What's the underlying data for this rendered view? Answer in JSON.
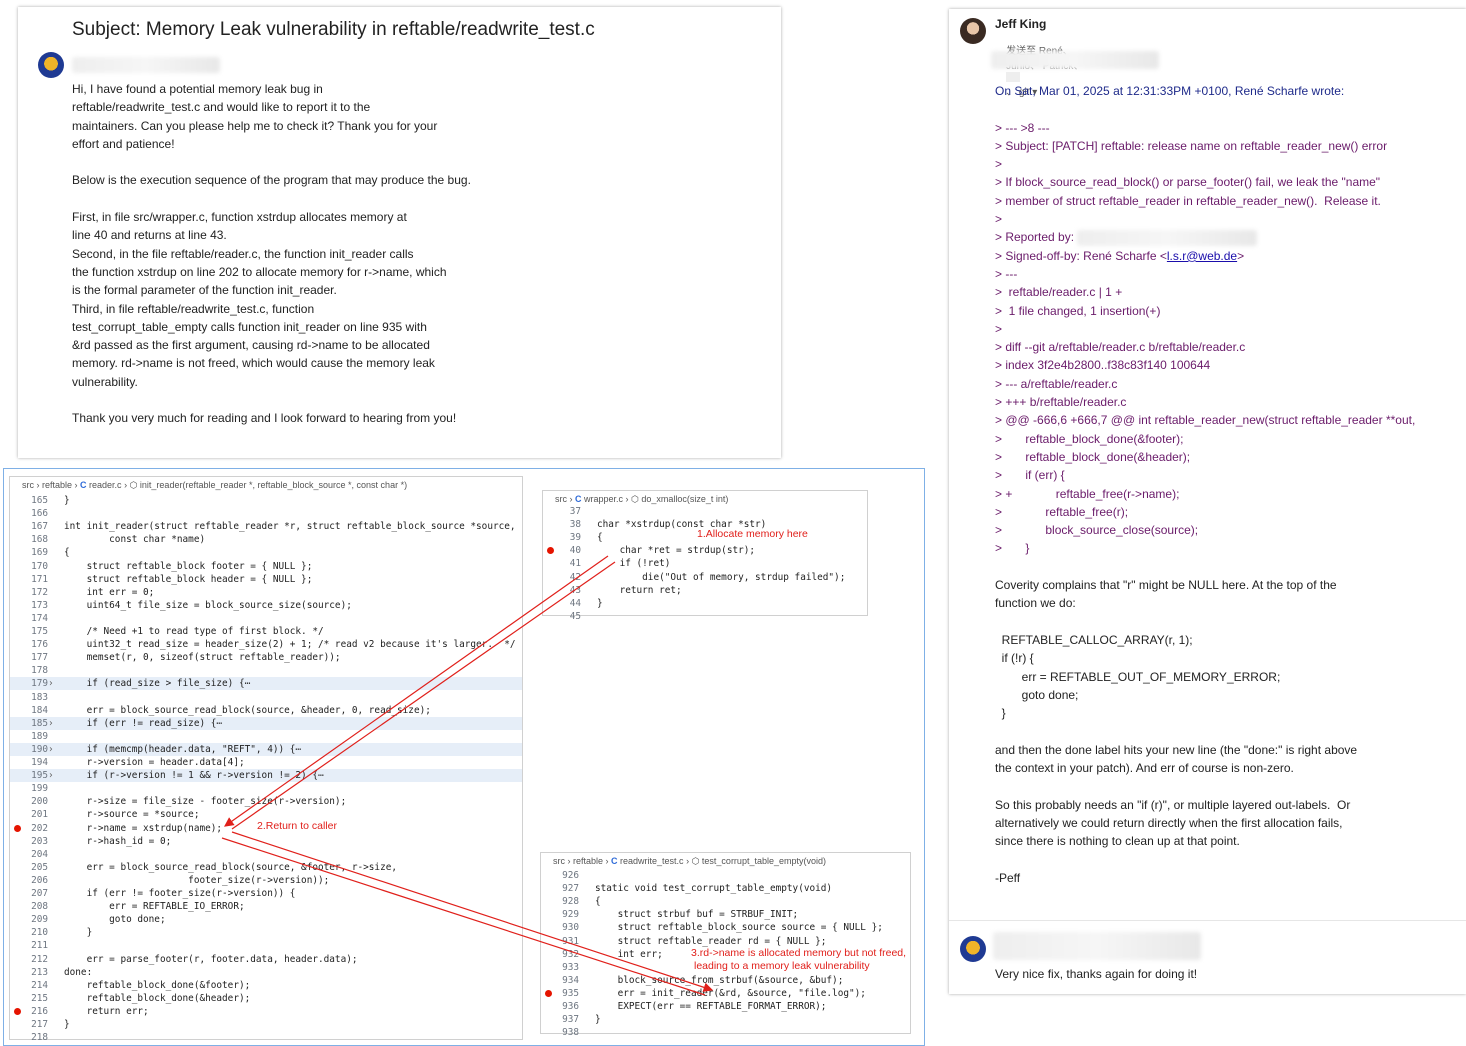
{
  "email_left": {
    "subject": "Subject: Memory Leak vulnerability in reftable/readwrite_test.c",
    "lines": [
      "Hi, I have found a potential memory leak bug in",
      "reftable/readwrite_test.c and would like to report it to the",
      "maintainers. Can you please help me to check it? Thank you for your",
      "effort and patience!",
      "",
      "Below is the execution sequence of the program that may produce the bug.",
      "",
      "First, in file src/wrapper.c, function xstrdup allocates memory at",
      "line 40 and returns at line 43.",
      "Second, in the file reftable/reader.c, the function init_reader calls",
      "the function xstrdup on line 202 to allocate memory for r->name, which",
      "is the formal parameter of the function init_reader.",
      "Third, in file reftable/readwrite_test.c, function",
      "test_corrupt_table_empty calls function init_reader on line 935 with",
      "&rd passed as the first argument, causing rd->name to be allocated",
      "memory. rd->name is not freed, which would cause the memory leak",
      "vulnerability.",
      "",
      "Thank you very much for reading and I look forward to hearing from you!"
    ]
  },
  "email_right": {
    "sender": "Jeff King",
    "recipients_prefix": "发送至 René、",
    "recipients": "Junio、 Patrick、",
    "recipients_tail": "、 git ▾",
    "lines": [
      {
        "t": "On Sat, Mar 01, 2025 at 12:31:33PM +0100, René Scharfe wrote:",
        "c": "blue"
      },
      {
        "t": "",
        "c": ""
      },
      {
        "t": "> --- >8 ---",
        "c": "purple"
      },
      {
        "t": "> Subject: [PATCH] reftable: release name on reftable_reader_new() error",
        "c": "purple"
      },
      {
        "t": ">",
        "c": "purple"
      },
      {
        "t": "> If block_source_read_block() or parse_footer() fail, we leak the \"name\"",
        "c": "purple"
      },
      {
        "t": "> member of struct reftable_reader in reftable_reader_new().  Release it.",
        "c": "purple"
      },
      {
        "t": ">",
        "c": "purple"
      },
      {
        "t": "> Reported by:",
        "c": "purple"
      },
      {
        "t": "> Signed-off-by: René Scharfe <",
        "c": "purple",
        "link": "l.s.r@web.de",
        "after": ">"
      },
      {
        "t": "> ---",
        "c": "purple"
      },
      {
        "t": ">  reftable/reader.c | 1 +",
        "c": "purple"
      },
      {
        "t": ">  1 file changed, 1 insertion(+)",
        "c": "purple"
      },
      {
        "t": ">",
        "c": "purple"
      },
      {
        "t": "> diff --git a/reftable/reader.c b/reftable/reader.c",
        "c": "purple"
      },
      {
        "t": "> index 3f2e4b2800..f38c83f140 100644",
        "c": "purple"
      },
      {
        "t": "> --- a/reftable/reader.c",
        "c": "purple"
      },
      {
        "t": "> +++ b/reftable/reader.c",
        "c": "purple"
      },
      {
        "t": "> @@ -666,6 +666,7 @@ int reftable_reader_new(struct reftable_reader **out,",
        "c": "purple"
      },
      {
        "t": ">       reftable_block_done(&footer);",
        "c": "purple"
      },
      {
        "t": ">       reftable_block_done(&header);",
        "c": "purple"
      },
      {
        "t": ">       if (err) {",
        "c": "purple"
      },
      {
        "t": "> +             reftable_free(r->name);",
        "c": "purple"
      },
      {
        "t": ">             reftable_free(r);",
        "c": "purple"
      },
      {
        "t": ">             block_source_close(source);",
        "c": "purple"
      },
      {
        "t": ">       }",
        "c": "purple"
      },
      {
        "t": "",
        "c": ""
      },
      {
        "t": "Coverity complains that \"r\" might be NULL here. At the top of the",
        "c": ""
      },
      {
        "t": "function we do:",
        "c": ""
      },
      {
        "t": "",
        "c": ""
      },
      {
        "t": "  REFTABLE_CALLOC_ARRAY(r, 1);",
        "c": ""
      },
      {
        "t": "  if (!r) {",
        "c": ""
      },
      {
        "t": "        err = REFTABLE_OUT_OF_MEMORY_ERROR;",
        "c": ""
      },
      {
        "t": "        goto done;",
        "c": ""
      },
      {
        "t": "  }",
        "c": ""
      },
      {
        "t": "",
        "c": ""
      },
      {
        "t": "and then the done label hits your new line (the \"done:\" is right above",
        "c": ""
      },
      {
        "t": "the context in your patch). And err of course is non-zero.",
        "c": ""
      },
      {
        "t": "",
        "c": ""
      },
      {
        "t": "So this probably needs an \"if (r)\", or multiple layered out-labels.  Or",
        "c": ""
      },
      {
        "t": "alternatively we could return directly when the first allocation fails,",
        "c": ""
      },
      {
        "t": "since there is nothing to clean up at that point.",
        "c": ""
      },
      {
        "t": "",
        "c": ""
      },
      {
        "t": "-Peff",
        "c": ""
      }
    ],
    "reply_text": "Very nice fix, thanks again for doing it!"
  },
  "reader_c": {
    "breadcrumb": [
      "src",
      "reftable",
      "reader.c",
      "init_reader(reftable_reader *, reftable_block_source *, const char *)"
    ],
    "lines": [
      {
        "n": "165",
        "t": "}"
      },
      {
        "n": "166",
        "t": ""
      },
      {
        "n": "167",
        "t": "int init_reader(struct reftable_reader *r, struct reftable_block_source *source,"
      },
      {
        "n": "168",
        "t": "        const char *name)"
      },
      {
        "n": "169",
        "t": "{"
      },
      {
        "n": "170",
        "t": "    struct reftable_block footer = { NULL };"
      },
      {
        "n": "171",
        "t": "    struct reftable_block header = { NULL };"
      },
      {
        "n": "172",
        "t": "    int err = 0;"
      },
      {
        "n": "173",
        "t": "    uint64_t file_size = block_source_size(source);"
      },
      {
        "n": "174",
        "t": ""
      },
      {
        "n": "175",
        "t": "    /* Need +1 to read type of first block. */"
      },
      {
        "n": "176",
        "t": "    uint32_t read_size = header_size(2) + 1; /* read v2 because it's larger.  */"
      },
      {
        "n": "177",
        "t": "    memset(r, 0, sizeof(struct reftable_reader));"
      },
      {
        "n": "178",
        "t": ""
      },
      {
        "n": "179",
        "t": "    if (read_size > file_size) {⋯",
        "hl": true
      },
      {
        "n": "183",
        "t": ""
      },
      {
        "n": "184",
        "t": "    err = block_source_read_block(source, &header, 0, read_size);"
      },
      {
        "n": "185",
        "t": "    if (err != read_size) {⋯",
        "hl": true
      },
      {
        "n": "189",
        "t": ""
      },
      {
        "n": "190",
        "t": "    if (memcmp(header.data, \"REFT\", 4)) {⋯",
        "hl": true
      },
      {
        "n": "194",
        "t": "    r->version = header.data[4];"
      },
      {
        "n": "195",
        "t": "    if (r->version != 1 && r->version != 2) {⋯",
        "hl": true
      },
      {
        "n": "199",
        "t": ""
      },
      {
        "n": "200",
        "t": "    r->size = file_size - footer_size(r->version);"
      },
      {
        "n": "201",
        "t": "    r->source = *source;"
      },
      {
        "n": "202",
        "t": "    r->name = xstrdup(name);",
        "bp": true
      },
      {
        "n": "203",
        "t": "    r->hash_id = 0;"
      },
      {
        "n": "204",
        "t": ""
      },
      {
        "n": "205",
        "t": "    err = block_source_read_block(source, &footer, r->size,"
      },
      {
        "n": "206",
        "t": "                      footer_size(r->version));"
      },
      {
        "n": "207",
        "t": "    if (err != footer_size(r->version)) {"
      },
      {
        "n": "208",
        "t": "        err = REFTABLE_IO_ERROR;"
      },
      {
        "n": "209",
        "t": "        goto done;"
      },
      {
        "n": "210",
        "t": "    }"
      },
      {
        "n": "211",
        "t": ""
      },
      {
        "n": "212",
        "t": "    err = parse_footer(r, footer.data, header.data);"
      },
      {
        "n": "213",
        "t": "done:"
      },
      {
        "n": "214",
        "t": "    reftable_block_done(&footer);"
      },
      {
        "n": "215",
        "t": "    reftable_block_done(&header);"
      },
      {
        "n": "216",
        "t": "    return err;",
        "bp": true
      },
      {
        "n": "217",
        "t": "}"
      },
      {
        "n": "218",
        "t": ""
      }
    ]
  },
  "wrapper_c": {
    "breadcrumb": [
      "src",
      "wrapper.c",
      "do_xmalloc(size_t int)"
    ],
    "lines": [
      {
        "n": "37",
        "t": ""
      },
      {
        "n": "38",
        "t": "char *xstrdup(const char *str)"
      },
      {
        "n": "39",
        "t": "{"
      },
      {
        "n": "40",
        "t": "    char *ret = strdup(str);",
        "bp": true
      },
      {
        "n": "41",
        "t": "    if (!ret)"
      },
      {
        "n": "42",
        "t": "        die(\"Out of memory, strdup failed\");"
      },
      {
        "n": "43",
        "t": "    return ret;"
      },
      {
        "n": "44",
        "t": "}"
      },
      {
        "n": "45",
        "t": ""
      }
    ]
  },
  "readwrite_test_c": {
    "breadcrumb": [
      "src",
      "reftable",
      "readwrite_test.c",
      "test_corrupt_table_empty(void)"
    ],
    "lines": [
      {
        "n": "926",
        "t": ""
      },
      {
        "n": "927",
        "t": "static void test_corrupt_table_empty(void)"
      },
      {
        "n": "928",
        "t": "{"
      },
      {
        "n": "929",
        "t": "    struct strbuf buf = STRBUF_INIT;"
      },
      {
        "n": "930",
        "t": "    struct reftable_block_source source = { NULL };"
      },
      {
        "n": "931",
        "t": "    struct reftable_reader rd = { NULL };"
      },
      {
        "n": "932",
        "t": "    int err;"
      },
      {
        "n": "933",
        "t": ""
      },
      {
        "n": "934",
        "t": "    block_source_from_strbuf(&source, &buf);"
      },
      {
        "n": "935",
        "t": "    err = init_reader(&rd, &source, \"file.log\");",
        "bp": true
      },
      {
        "n": "936",
        "t": "    EXPECT(err == REFTABLE_FORMAT_ERROR);"
      },
      {
        "n": "937",
        "t": "}"
      },
      {
        "n": "938",
        "t": ""
      }
    ]
  },
  "annotations": {
    "a1": "1.Allocate memory here",
    "a2": "2.Return to caller",
    "a3_1": "3.rd->name is allocated memory but not freed,",
    "a3_2": "leading to a memory leak vulnerability"
  },
  "colors": {
    "annotation": "#e0201b",
    "breakpoint": "#e51400",
    "link": "#1a0dab"
  }
}
